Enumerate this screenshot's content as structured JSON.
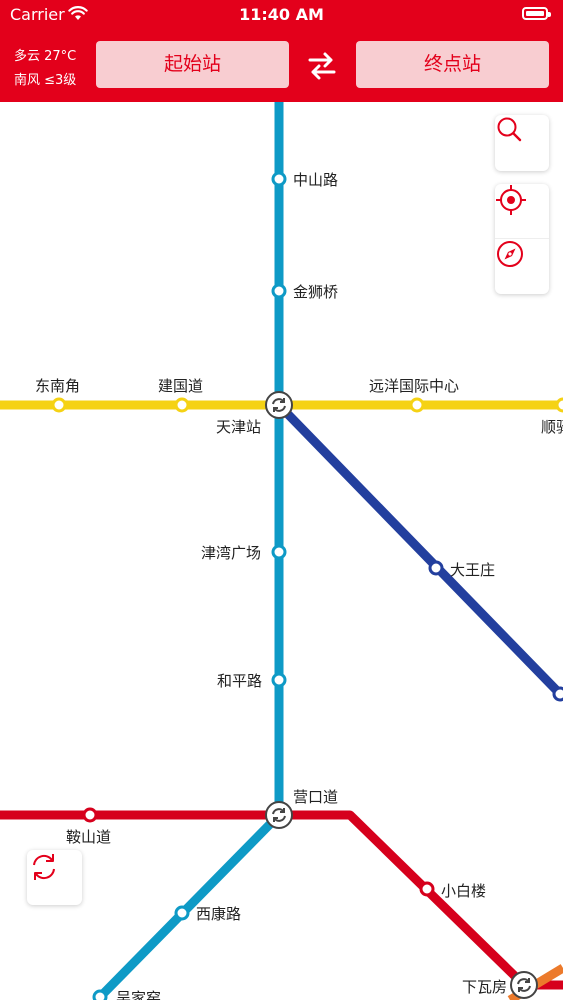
{
  "status_bar": {
    "carrier": "Carrier",
    "time": "11:40 AM"
  },
  "weather": {
    "line1": "多云 27°C",
    "line2": "南风 ≤3级"
  },
  "route": {
    "start_label": "起始站",
    "end_label": "终点站"
  },
  "colors": {
    "brand": "#e3001b",
    "button_bg": "#f8cdd1",
    "line_blue": "#0e9ac6",
    "line_yellow": "#f5d214",
    "line_navy": "#233f9e",
    "line_red": "#d6001c",
    "line_orange": "#ec7a2b"
  },
  "stations": {
    "zhongshan": "中山路",
    "jinshiqiao": "金狮桥",
    "dongnanjiao": "东南角",
    "jianguodao": "建国道",
    "tianjin": "天津站",
    "yuanyang": "远洋国际中心",
    "shunyi": "顺驿",
    "jinwan": "津湾广场",
    "dawangzhuang": "大王庄",
    "heping": "和平路",
    "yingkou": "营口道",
    "anshan": "鞍山道",
    "xiaobailou": "小白楼",
    "xikang": "西康路",
    "wujiayao": "吴家窑",
    "xiawafang": "下瓦房"
  },
  "icons": [
    "wifi-icon",
    "battery-icon",
    "swap-icon",
    "search-icon",
    "locate-icon",
    "compass-icon",
    "refresh-icon",
    "transfer-icon"
  ]
}
